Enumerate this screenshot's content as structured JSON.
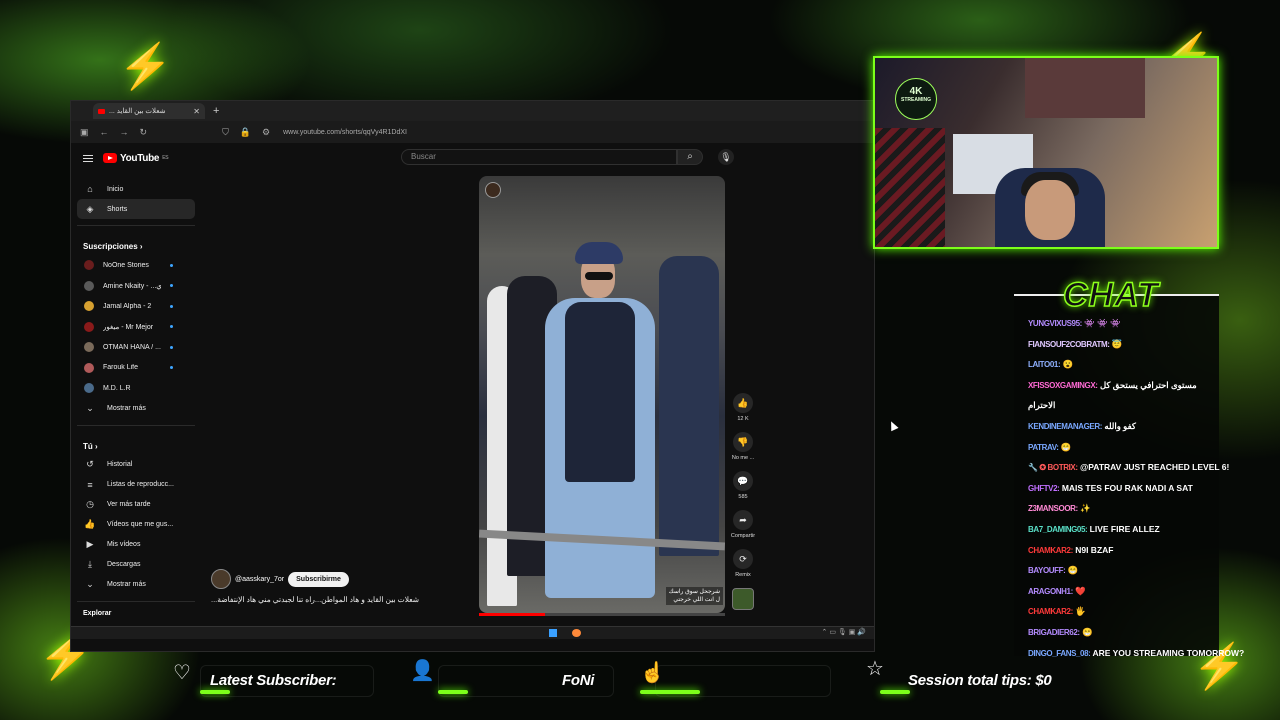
{
  "browser": {
    "tab_title": "شعلات بين القايد ...",
    "new_tab": "+",
    "url": "www.youtube.com/shorts/qqVy4R1DdXI"
  },
  "youtube": {
    "logo_text": "YouTube",
    "logo_country": "ES",
    "search_placeholder": "Buscar",
    "nav": [
      {
        "label": "Inicio",
        "icon": "⌂"
      },
      {
        "label": "Shorts",
        "icon": "◈"
      }
    ],
    "subscriptions_header": "Suscripciones ›",
    "channels": [
      {
        "name": "NoOne Stories",
        "color": "#6a1d1d",
        "live": true
      },
      {
        "name": "Amine Nkaity - ...ي",
        "color": "#5a5a5a",
        "live": true
      },
      {
        "name": "Jamal Alpha - 2",
        "color": "#d6a030",
        "live": true
      },
      {
        "name": "ميغور - Mr Mejor",
        "color": "#8a1a1a",
        "live": true
      },
      {
        "name": "OTMAN HANA / ...",
        "color": "#7a6a5a",
        "live": true
      },
      {
        "name": "Farouk Life",
        "color": "#b05a5a",
        "live": true
      },
      {
        "name": "M.D. L.R",
        "color": "#4a6a8a",
        "live": false
      }
    ],
    "show_more_subs": "Mostrar más",
    "you_header": "Tú ›",
    "you_items": [
      {
        "label": "Historial",
        "icon": "↺"
      },
      {
        "label": "Listas de reproducc...",
        "icon": "≡"
      },
      {
        "label": "Ver más tarde",
        "icon": "◷"
      },
      {
        "label": "Vídeos que me gus...",
        "icon": "👍"
      },
      {
        "label": "Mis vídeos",
        "icon": "▶"
      },
      {
        "label": "Descargas",
        "icon": "⤓"
      },
      {
        "label": "Mostrar más",
        "icon": "⌄"
      }
    ],
    "explore_header": "Explorar",
    "short": {
      "channel": "@aasskary_7or",
      "subscribe": "Subscribirme",
      "title": "شعلات بين القايد و هاد المواطن...راه تنا لجبدتي مني هاد الإنتفاضة...",
      "overlay_caption": "شرجحل سوق راسك\nل انت اللي خرجتي",
      "progress": 0.27,
      "actions": [
        {
          "name": "like",
          "icon": "👍",
          "count": "12 K"
        },
        {
          "name": "dislike",
          "icon": "👎",
          "count": "No me ..."
        },
        {
          "name": "comments",
          "icon": "💬",
          "count": "585"
        },
        {
          "name": "share",
          "icon": "➦",
          "count": "Compartir"
        },
        {
          "name": "remix",
          "icon": "⟳",
          "count": "Remix"
        }
      ]
    }
  },
  "cam": {
    "logo_main": "4K",
    "logo_sub": "STREAMING"
  },
  "chat": {
    "title": "CHAT",
    "messages": [
      {
        "user": "YUNGVIXUS95:",
        "color": "#b48cff",
        "text": "👾 👾 👾"
      },
      {
        "user": "FIANSOUF2COBRATM:",
        "color": "#e0c8ff",
        "text": "😇"
      },
      {
        "user": "LAITO01:",
        "color": "#8fb0ff",
        "text": "😮"
      },
      {
        "user": "XFISSOXGAMINGX:",
        "color": "#ff6ad5",
        "text": "مستوى احترافي يستحق كل"
      },
      {
        "user": "",
        "color": "#ffffff",
        "text": "الاحترام"
      },
      {
        "user": "KENDINEMANAGER:",
        "color": "#7aa8ff",
        "text": "كفو والله"
      },
      {
        "user": "PATRAV:",
        "color": "#7aa8ff",
        "text": "😁"
      },
      {
        "user": "🔧 ✪ BOTRIX:",
        "color": "#ff5a5a",
        "text": "@PATRAV JUST REACHED LEVEL 6!"
      },
      {
        "user": "GHFTV2:",
        "color": "#c070ff",
        "text": "MAIS TES FOU RAK NADI A SAT"
      },
      {
        "user": "Z3MANSOOR:",
        "color": "#ff8ad5",
        "text": "✨"
      },
      {
        "user": "BA7_DAMING05:",
        "color": "#5ae0c8",
        "text": "LIVE FIRE ALLEZ"
      },
      {
        "user": "CHAMKAR2:",
        "color": "#ff3a3a",
        "text": "N9I BZAF"
      },
      {
        "user": "BAYOUFF:",
        "color": "#b48cff",
        "text": "😁"
      },
      {
        "user": "ARAGONH1:",
        "color": "#b48cff",
        "text": "❤️"
      },
      {
        "user": "CHAMKAR2:",
        "color": "#ff3a3a",
        "text": "🖐"
      },
      {
        "user": "BRIGADIER62:",
        "color": "#b48cff",
        "text": "😁"
      },
      {
        "user": "DINGO_FANS_08:",
        "color": "#7aa8ff",
        "text": "ARE YOU STREAMING TOMORROW?"
      }
    ]
  },
  "bottom_bar": {
    "latest_subscriber_label": "Latest Subscriber:",
    "latest_follower_name": "FoNi",
    "session_tips": "Session total tips: $0"
  },
  "colors": {
    "accent_green": "#7cff1a",
    "youtube_red": "#ff0000"
  }
}
